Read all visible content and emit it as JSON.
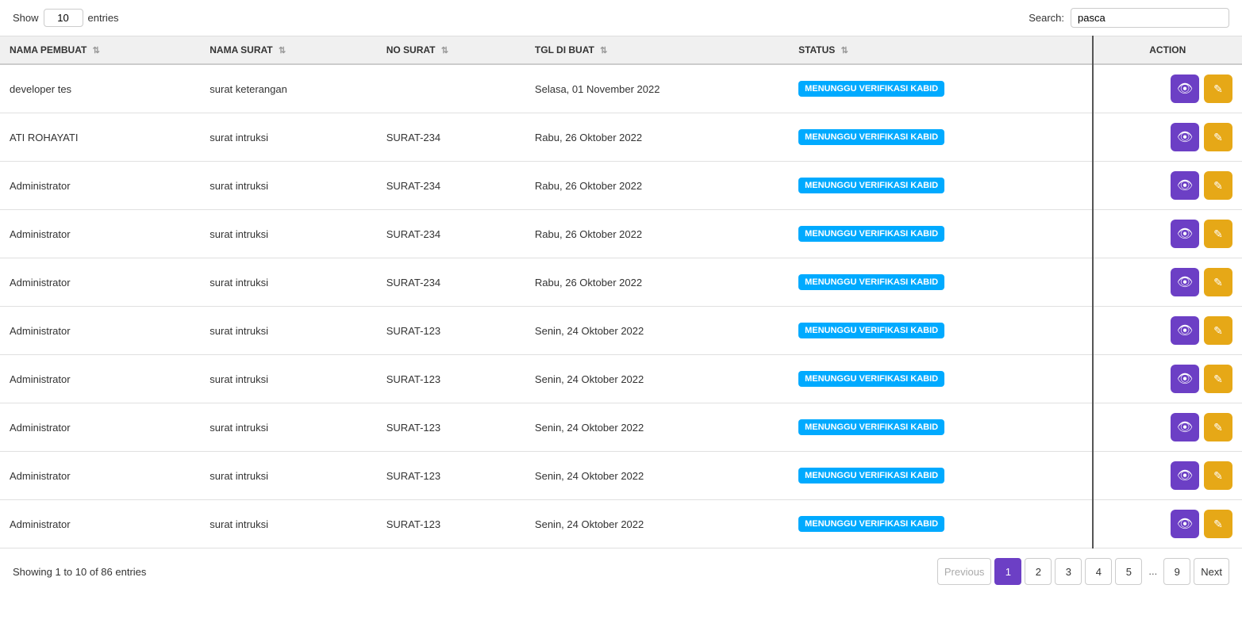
{
  "top": {
    "show_label": "Show",
    "entries_label": "entries",
    "show_value": "10",
    "search_label": "Search:",
    "search_value": "pasca"
  },
  "columns": [
    {
      "key": "nama_pembuat",
      "label": "NAMA PEMBUAT"
    },
    {
      "key": "nama_surat",
      "label": "NAMA SURAT"
    },
    {
      "key": "no_surat",
      "label": "NO SURAT"
    },
    {
      "key": "tgl_di_buat",
      "label": "TGL DI BUAT"
    },
    {
      "key": "status",
      "label": "STATUS"
    },
    {
      "key": "action",
      "label": "ACTION"
    }
  ],
  "rows": [
    {
      "nama_pembuat": "developer tes",
      "nama_surat": "surat keterangan",
      "no_surat": "",
      "tgl_di_buat": "Selasa, 01 November 2022",
      "status": "MENUNGGU VERIFIKASI KABID"
    },
    {
      "nama_pembuat": "ATI ROHAYATI",
      "nama_surat": "surat intruksi",
      "no_surat": "SURAT-234",
      "tgl_di_buat": "Rabu, 26 Oktober 2022",
      "status": "MENUNGGU VERIFIKASI KABID"
    },
    {
      "nama_pembuat": "Administrator",
      "nama_surat": "surat intruksi",
      "no_surat": "SURAT-234",
      "tgl_di_buat": "Rabu, 26 Oktober 2022",
      "status": "MENUNGGU VERIFIKASI KABID"
    },
    {
      "nama_pembuat": "Administrator",
      "nama_surat": "surat intruksi",
      "no_surat": "SURAT-234",
      "tgl_di_buat": "Rabu, 26 Oktober 2022",
      "status": "MENUNGGU VERIFIKASI KABID"
    },
    {
      "nama_pembuat": "Administrator",
      "nama_surat": "surat intruksi",
      "no_surat": "SURAT-234",
      "tgl_di_buat": "Rabu, 26 Oktober 2022",
      "status": "MENUNGGU VERIFIKASI KABID"
    },
    {
      "nama_pembuat": "Administrator",
      "nama_surat": "surat intruksi",
      "no_surat": "SURAT-123",
      "tgl_di_buat": "Senin, 24 Oktober 2022",
      "status": "MENUNGGU VERIFIKASI KABID"
    },
    {
      "nama_pembuat": "Administrator",
      "nama_surat": "surat intruksi",
      "no_surat": "SURAT-123",
      "tgl_di_buat": "Senin, 24 Oktober 2022",
      "status": "MENUNGGU VERIFIKASI KABID"
    },
    {
      "nama_pembuat": "Administrator",
      "nama_surat": "surat intruksi",
      "no_surat": "SURAT-123",
      "tgl_di_buat": "Senin, 24 Oktober 2022",
      "status": "MENUNGGU VERIFIKASI KABID"
    },
    {
      "nama_pembuat": "Administrator",
      "nama_surat": "surat intruksi",
      "no_surat": "SURAT-123",
      "tgl_di_buat": "Senin, 24 Oktober 2022",
      "status": "MENUNGGU VERIFIKASI KABID"
    },
    {
      "nama_pembuat": "Administrator",
      "nama_surat": "surat intruksi",
      "no_surat": "SURAT-123",
      "tgl_di_buat": "Senin, 24 Oktober 2022",
      "status": "MENUNGGU VERIFIKASI KABID"
    }
  ],
  "footer": {
    "showing_text": "Showing 1 to 10 of 86 entries"
  },
  "pagination": {
    "previous_label": "Previous",
    "next_label": "Next",
    "pages": [
      "1",
      "2",
      "3",
      "4",
      "5",
      "9"
    ],
    "active_page": "1",
    "ellipsis_after": 5
  },
  "icons": {
    "sort": "⇅",
    "eye": "👁",
    "edit": "✎"
  }
}
